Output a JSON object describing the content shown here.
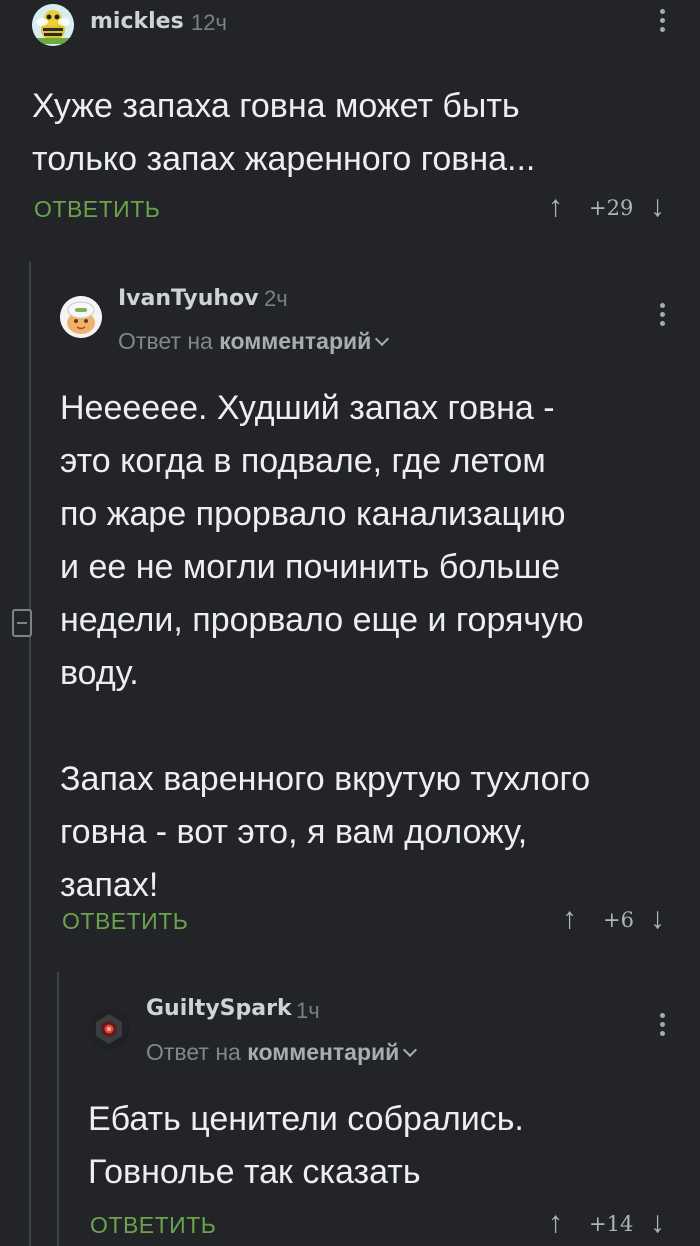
{
  "comments": [
    {
      "username": "mickles",
      "time": "12ч",
      "body_lines": [
        "Хуже запаха говна может быть",
        "только запах жаренного говна..."
      ],
      "reply_label": "ОТВЕТИТЬ",
      "score": "+29"
    },
    {
      "username": "IvanTyuhov",
      "time": "2ч",
      "reply_to_prefix": "Ответ на",
      "reply_to_target": "комментарий",
      "body_lines": [
        "Нееееее. Худший запах говна -",
        "это когда в подвале, где летом",
        "по жаре прорвало канализацию",
        "и ее не могли починить больше",
        "недели, прорвало еще и горячую",
        "воду.",
        "",
        "Запах варенного вкрутую тухлого",
        "говна - вот это, я вам доложу,",
        "запах!"
      ],
      "reply_label": "ОТВЕТИТЬ",
      "score": "+6"
    },
    {
      "username": "GuiltySpark",
      "time": "1ч",
      "reply_to_prefix": "Ответ на",
      "reply_to_target": "комментарий",
      "body_lines": [
        "Ебать ценители собрались.",
        "Говнолье так сказать"
      ],
      "reply_label": "ОТВЕТИТЬ",
      "score": "+14"
    }
  ],
  "icons": {
    "upvote": "↑",
    "downvote": "↓",
    "menu": "more-vertical-icon",
    "collapse": "collapse-thread-icon"
  },
  "colors": {
    "background": "#222427",
    "reply_green": "#6ba34c",
    "thread_line": "#3e4246"
  }
}
